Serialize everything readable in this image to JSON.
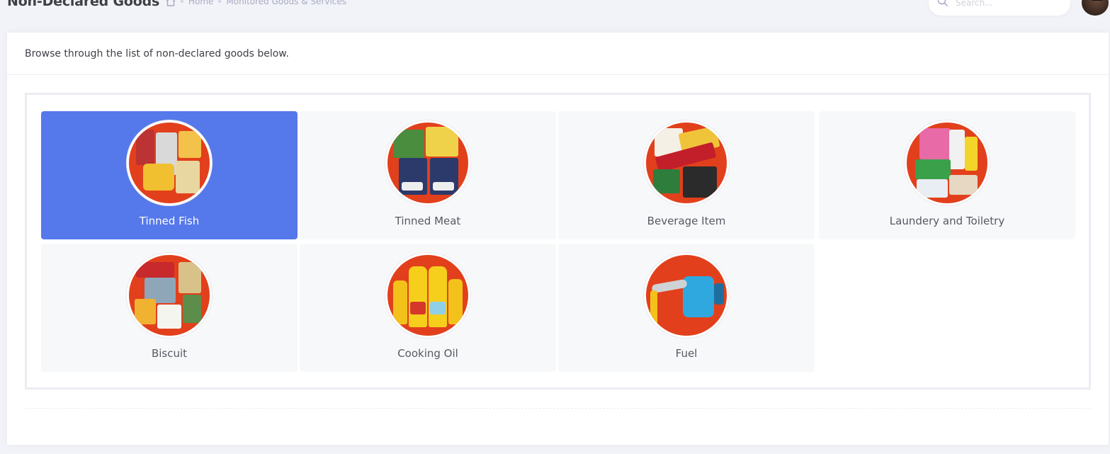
{
  "header": {
    "title": "Non-Declared Goods",
    "breadcrumb": [
      "Home",
      "Monitored Goods & Services"
    ],
    "search_placeholder": "Search..."
  },
  "card": {
    "intro": "Browse through the list of non-declared goods below."
  },
  "categories": [
    {
      "label": "Tinned Fish",
      "active": true
    },
    {
      "label": "Tinned Meat",
      "active": false
    },
    {
      "label": "Beverage Item",
      "active": false
    },
    {
      "label": "Laundery and Toiletry",
      "active": false
    },
    {
      "label": "Biscuit",
      "active": false
    },
    {
      "label": "Cooking Oil",
      "active": false
    },
    {
      "label": "Fuel",
      "active": false
    }
  ],
  "colors": {
    "accent": "#5578eb",
    "circle_bg": "#e2401c",
    "page_bg": "#f2f3f8"
  }
}
